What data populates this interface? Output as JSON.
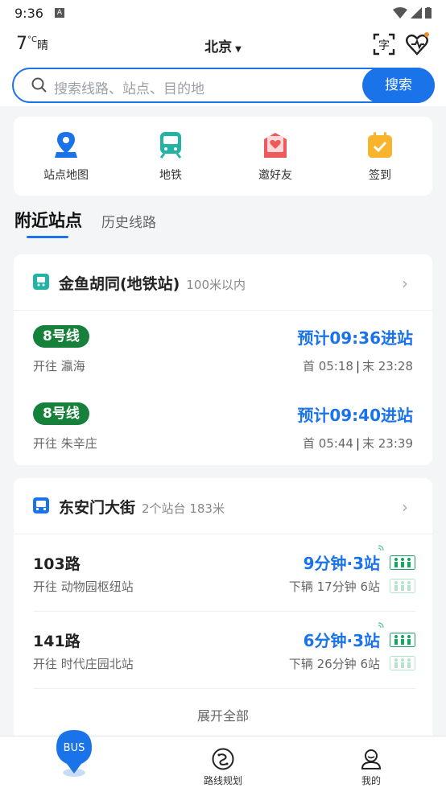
{
  "status": {
    "time": "9:36",
    "sim_label": "A"
  },
  "header": {
    "temperature": "7",
    "temp_unit": "°C",
    "condition": "晴",
    "city": "北京",
    "search_placeholder": "搜索线路、站点、目的地",
    "search_button": "搜索"
  },
  "quick_actions": [
    {
      "label": "站点地图",
      "icon": "location-pin-icon"
    },
    {
      "label": "地铁",
      "icon": "subway-icon"
    },
    {
      "label": "邀好友",
      "icon": "invite-heart-icon"
    },
    {
      "label": "签到",
      "icon": "checkin-calendar-icon"
    }
  ],
  "tabs": {
    "active": "附近站点",
    "inactive": "历史线路"
  },
  "subway_station": {
    "name": "金鱼胡同(地铁站)",
    "distance": "100米以内",
    "rows": [
      {
        "line": "8号线",
        "direction": "开往 瀛海",
        "eta": "预计09:36进站",
        "first": "首 05:18",
        "sep": "|",
        "last": "末 23:28"
      },
      {
        "line": "8号线",
        "direction": "开往 朱辛庄",
        "eta": "预计09:40进站",
        "first": "首 05:44",
        "sep": "|",
        "last": "末 23:39"
      }
    ]
  },
  "bus_station": {
    "name": "东安门大街",
    "distance": "2个站台 183米",
    "rows": [
      {
        "route": "103路",
        "direction": "开往 动物园枢纽站",
        "eta": "9分钟·3站",
        "next": "下辆  17分钟 6站"
      },
      {
        "route": "141路",
        "direction": "开往 时代庄园北站",
        "eta": "6分钟·3站",
        "next": "下辆  26分钟 6站"
      }
    ],
    "expand_label": "展开全部"
  },
  "bottom_nav": {
    "bus_label": "BUS",
    "route_plan": "路线规划",
    "mine": "我的"
  },
  "colors": {
    "accent": "#1a73e8",
    "line8": "#15813b",
    "notify_dot": "#f08a24"
  }
}
